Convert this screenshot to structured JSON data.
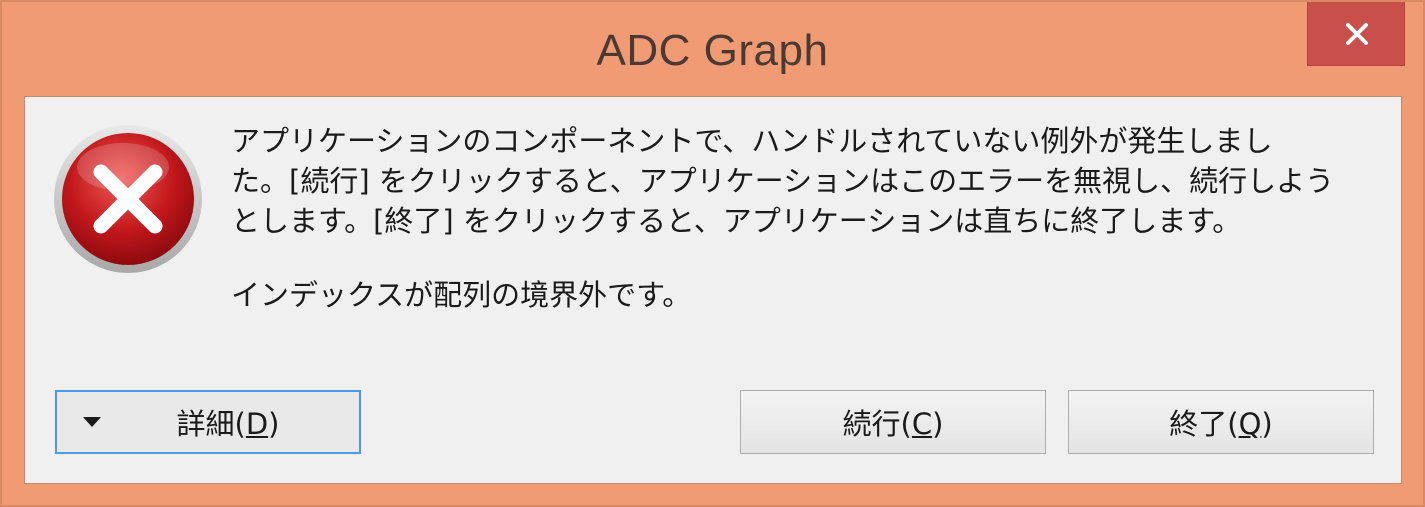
{
  "window": {
    "title": "ADC Graph",
    "close_glyph": "✕",
    "colors": {
      "frame": "#f09b74",
      "close_button": "#c9504a",
      "client": "#f0f0f0",
      "focus_border": "#4a9be8"
    }
  },
  "icon": {
    "name": "error-icon",
    "color": "#c0141a"
  },
  "message": {
    "lines": [
      "アプリケーションのコンポーネントで、ハンドルされていない例外が発生しまし",
      "た。[続行] をクリックすると、アプリケーションはこのエラーを無視し、続行しよう",
      "とします。[終了] をクリックすると、アプリケーションは直ちに終了します。"
    ],
    "detail": "インデックスが配列の境界外です。"
  },
  "buttons": {
    "details": {
      "text": "詳細(",
      "mnemonic": "D",
      "close": ")"
    },
    "continue": {
      "text": "続行(",
      "mnemonic": "C",
      "close": ")"
    },
    "quit": {
      "text": "終了(",
      "mnemonic": "Q",
      "close": ")"
    }
  }
}
